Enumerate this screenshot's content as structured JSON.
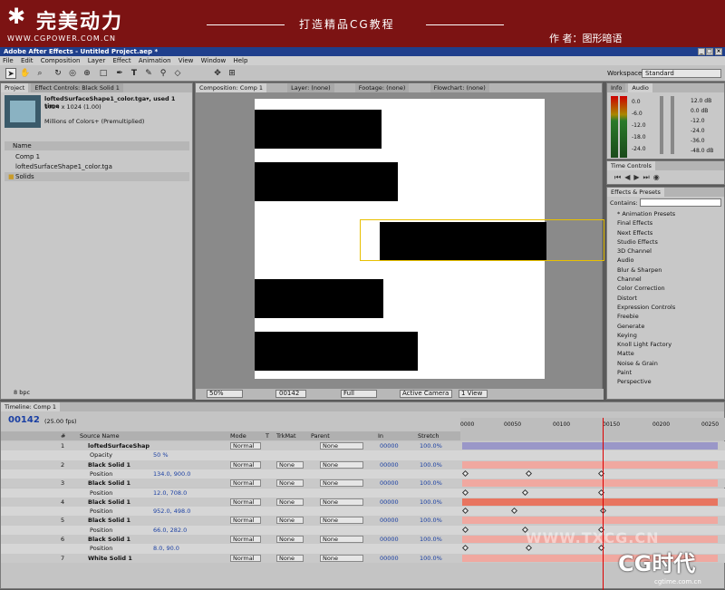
{
  "banner": {
    "logo": "完美动力",
    "url": "WWW.CGPOWER.COM.CN",
    "slogan": "打造精品CG教程",
    "author": "作 者：图形暗语"
  },
  "window": {
    "title": "Adobe After Effects - Untitled Project.aep *",
    "btn_min": "_",
    "btn_max": "□",
    "btn_close": "×"
  },
  "menu": [
    "File",
    "Edit",
    "Composition",
    "Layer",
    "Effect",
    "Animation",
    "View",
    "Window",
    "Help"
  ],
  "toolbar": {
    "workspace_label": "Workspace:",
    "workspace_value": "Standard"
  },
  "project": {
    "tab": "Project",
    "effect_tab": "Effect Controls: Black Solid 1",
    "file_name": "loftedSurfaceShape1_color.tga▾, used 1 time",
    "dims": "1024 x 1024 (1.00)",
    "colors": "Millions of Colors+ (Premultiplied)",
    "col_name": "Name",
    "items": [
      "Comp 1",
      "loftedSurfaceShape1_color.tga",
      "Solids"
    ],
    "bpc": "8 bpc"
  },
  "comp": {
    "tab": "Composition: Comp 1",
    "layer_tab": "Layer: (none)",
    "footage_tab": "Footage: (none)",
    "flowchart_tab": "Flowchart: (none)",
    "zoom": "50%",
    "timecode": "00142",
    "resolution": "Full",
    "camera": "Active Camera",
    "view": "1 View"
  },
  "info": {
    "tab_info": "Info",
    "tab_audio": "Audio",
    "levels_left": [
      "0.0",
      "-6.0",
      "-12.0",
      "-18.0",
      "-24.0"
    ],
    "levels_right": [
      "12.0 dB",
      "0.0 dB",
      "-12.0",
      "-24.0",
      "-36.0",
      "-48.0 dB"
    ]
  },
  "time_controls": {
    "tab": "Time Controls"
  },
  "effects": {
    "tab": "Effects & Presets",
    "contains": "Contains:",
    "items": [
      "* Animation Presets",
      "Final Effects",
      "Next Effects",
      "Studio Effects",
      "3D Channel",
      "Audio",
      "Blur & Sharpen",
      "Channel",
      "Color Correction",
      "Distort",
      "Expression Controls",
      "Freebie",
      "Generate",
      "Keying",
      "Knoll Light Factory",
      "Matte",
      "Noise & Grain",
      "Paint",
      "Perspective"
    ]
  },
  "timeline": {
    "tab": "Timeline: Comp 1",
    "timecode": "00142",
    "fps": "(25.00 fps)",
    "headers": {
      "num": "#",
      "source": "Source Name",
      "mode": "Mode",
      "t": "T",
      "trkmat": "TrkMat",
      "parent": "Parent",
      "in": "In",
      "stretch": "Stretch"
    },
    "ruler": [
      "0000",
      "00050",
      "00100",
      "00150",
      "00200",
      "00250"
    ],
    "rows": [
      {
        "type": "layer",
        "num": "1",
        "name": "loftedSurfaceShap",
        "mode": "Normal",
        "trkmat": "",
        "parent": "None",
        "in": "00000",
        "stretch": "100.0%"
      },
      {
        "type": "prop",
        "name": "Opacity",
        "value": "50 %"
      },
      {
        "type": "layer",
        "num": "2",
        "name": "Black Solid 1",
        "mode": "Normal",
        "trkmat": "None",
        "parent": "None",
        "in": "00000",
        "stretch": "100.0%"
      },
      {
        "type": "prop",
        "name": "Position",
        "value": "134.0, 900.0"
      },
      {
        "type": "layer",
        "num": "3",
        "name": "Black Solid 1",
        "mode": "Normal",
        "trkmat": "None",
        "parent": "None",
        "in": "00000",
        "stretch": "100.0%"
      },
      {
        "type": "prop",
        "name": "Position",
        "value": "12.0, 708.0"
      },
      {
        "type": "layer",
        "num": "4",
        "name": "Black Solid 1",
        "mode": "Normal",
        "trkmat": "None",
        "parent": "None",
        "in": "00000",
        "stretch": "100.0%"
      },
      {
        "type": "prop",
        "name": "Position",
        "value": "952.0, 498.0"
      },
      {
        "type": "layer",
        "num": "5",
        "name": "Black Solid 1",
        "mode": "Normal",
        "trkmat": "None",
        "parent": "None",
        "in": "00000",
        "stretch": "100.0%"
      },
      {
        "type": "prop",
        "name": "Position",
        "value": "66.0, 282.0"
      },
      {
        "type": "layer",
        "num": "6",
        "name": "Black Solid 1",
        "mode": "Normal",
        "trkmat": "None",
        "parent": "None",
        "in": "00000",
        "stretch": "100.0%"
      },
      {
        "type": "prop",
        "name": "Position",
        "value": "8.0, 90.0"
      },
      {
        "type": "layer",
        "num": "7",
        "name": "White Solid 1",
        "mode": "Normal",
        "trkmat": "None",
        "parent": "None",
        "in": "00000",
        "stretch": "100.0%"
      }
    ]
  },
  "watermark": {
    "text": "WWW.TXCG.CN",
    "brand": "CG时代",
    "site": "cgtime.com.cn"
  }
}
